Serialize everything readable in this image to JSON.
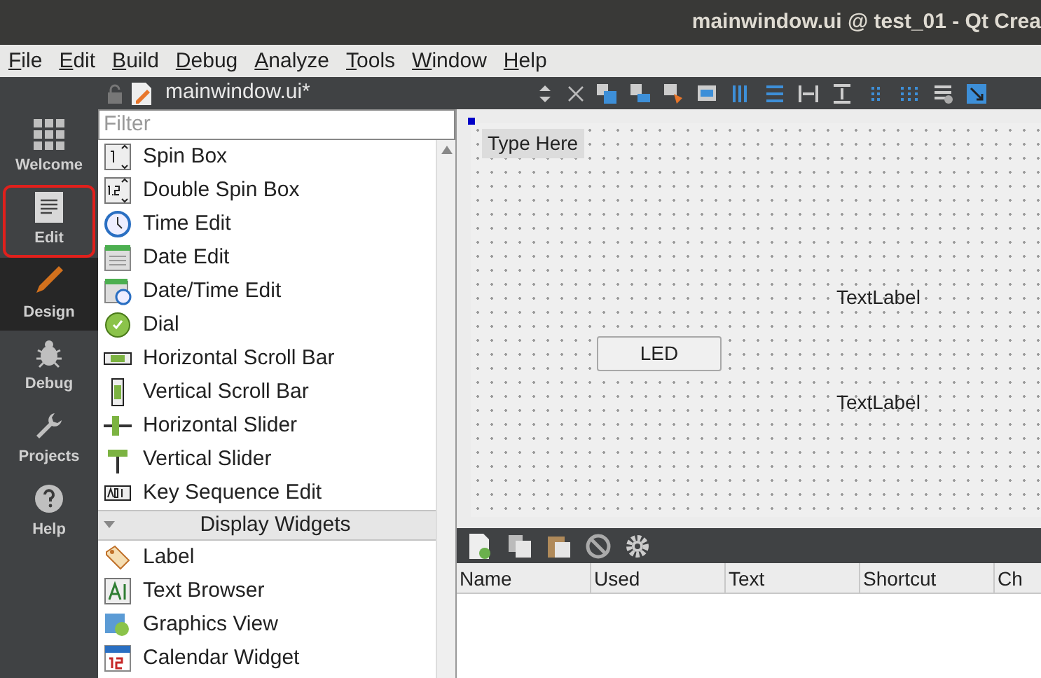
{
  "window": {
    "title": "mainwindow.ui @ test_01 - Qt Crea"
  },
  "menu": [
    "File",
    "Edit",
    "Build",
    "Debug",
    "Analyze",
    "Tools",
    "Window",
    "Help"
  ],
  "modes": [
    {
      "label": "Welcome",
      "kind": "grid",
      "selected": false,
      "highlighted": false
    },
    {
      "label": "Edit",
      "kind": "doc",
      "selected": false,
      "highlighted": true
    },
    {
      "label": "Design",
      "kind": "pencil",
      "selected": true,
      "highlighted": false
    },
    {
      "label": "Debug",
      "kind": "bug",
      "selected": false,
      "highlighted": false
    },
    {
      "label": "Projects",
      "kind": "wrench",
      "selected": false,
      "highlighted": false
    },
    {
      "label": "Help",
      "kind": "help",
      "selected": false,
      "highlighted": false
    }
  ],
  "document": {
    "name": "mainwindow.ui*"
  },
  "widget_box": {
    "filter": {
      "placeholder": "Filter"
    },
    "items": [
      {
        "label": "Spin Box",
        "kind": "spin"
      },
      {
        "label": "Double Spin Box",
        "kind": "spin2"
      },
      {
        "label": "Time Edit",
        "kind": "clock"
      },
      {
        "label": "Date Edit",
        "kind": "calendar"
      },
      {
        "label": "Date/Time Edit",
        "kind": "calclock"
      },
      {
        "label": "Dial",
        "kind": "dial"
      },
      {
        "label": "Horizontal Scroll Bar",
        "kind": "hscroll"
      },
      {
        "label": "Vertical Scroll Bar",
        "kind": "vscroll"
      },
      {
        "label": "Horizontal Slider",
        "kind": "hslider"
      },
      {
        "label": "Vertical Slider",
        "kind": "vslider"
      },
      {
        "label": "Key Sequence Edit",
        "kind": "key"
      },
      {
        "label": "Display Widgets",
        "kind": "section",
        "expanded": true
      },
      {
        "label": "Label",
        "kind": "tag"
      },
      {
        "label": "Text Browser",
        "kind": "textbrowser"
      },
      {
        "label": "Graphics View",
        "kind": "graphics"
      },
      {
        "label": "Calendar Widget",
        "kind": "cal12"
      }
    ]
  },
  "form": {
    "menu_placeholder": "Type Here",
    "button": "LED",
    "labels": [
      "TextLabel",
      "TextLabel"
    ]
  },
  "action_editor": {
    "columns": [
      "Name",
      "Used",
      "Text",
      "Shortcut",
      "Ch"
    ]
  }
}
